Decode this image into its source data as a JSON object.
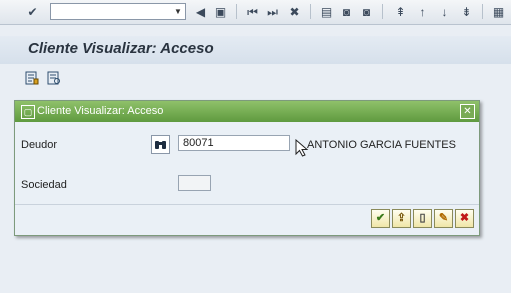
{
  "toolbar": {
    "command_field_value": "",
    "buttons": [
      {
        "name": "enter-icon",
        "glyph": "✔"
      },
      {
        "name": "back-triangle-icon",
        "glyph": "◀"
      },
      {
        "name": "save-icon",
        "glyph": "▣"
      },
      {
        "name": "back-icon",
        "glyph": "⏮"
      },
      {
        "name": "exit-icon",
        "glyph": "⏭"
      },
      {
        "name": "cancel-icon",
        "glyph": "✖"
      },
      {
        "name": "print-icon",
        "glyph": "▤"
      },
      {
        "name": "find-icon",
        "glyph": "◙"
      },
      {
        "name": "find-next-icon",
        "glyph": "◙"
      },
      {
        "name": "first-page-icon",
        "glyph": "⇞"
      },
      {
        "name": "previous-page-icon",
        "glyph": "↑"
      },
      {
        "name": "next-page-icon",
        "glyph": "↓"
      },
      {
        "name": "last-page-icon",
        "glyph": "⇟"
      },
      {
        "name": "layout-icon",
        "glyph": "▦"
      }
    ]
  },
  "page": {
    "title": "Cliente Visualizar: Acceso"
  },
  "dialog": {
    "title": "Cliente Visualizar: Acceso",
    "deudor_label": "Deudor",
    "deudor_value": "80071",
    "deudor_description": "ANTONIO GARCIA FUENTES",
    "sociedad_label": "Sociedad",
    "sociedad_value": "",
    "buttons": [
      {
        "name": "continue-icon",
        "glyph": "✔",
        "color": "#3a7a1a"
      },
      {
        "name": "data-icon",
        "glyph": "⇪",
        "color": "#7a5a10"
      },
      {
        "name": "new-document-icon",
        "glyph": "▯",
        "color": "#444444"
      },
      {
        "name": "edit-icon",
        "glyph": "✎",
        "color": "#b06a00"
      },
      {
        "name": "cancel-icon",
        "glyph": "✖",
        "color": "#c01818"
      }
    ]
  }
}
